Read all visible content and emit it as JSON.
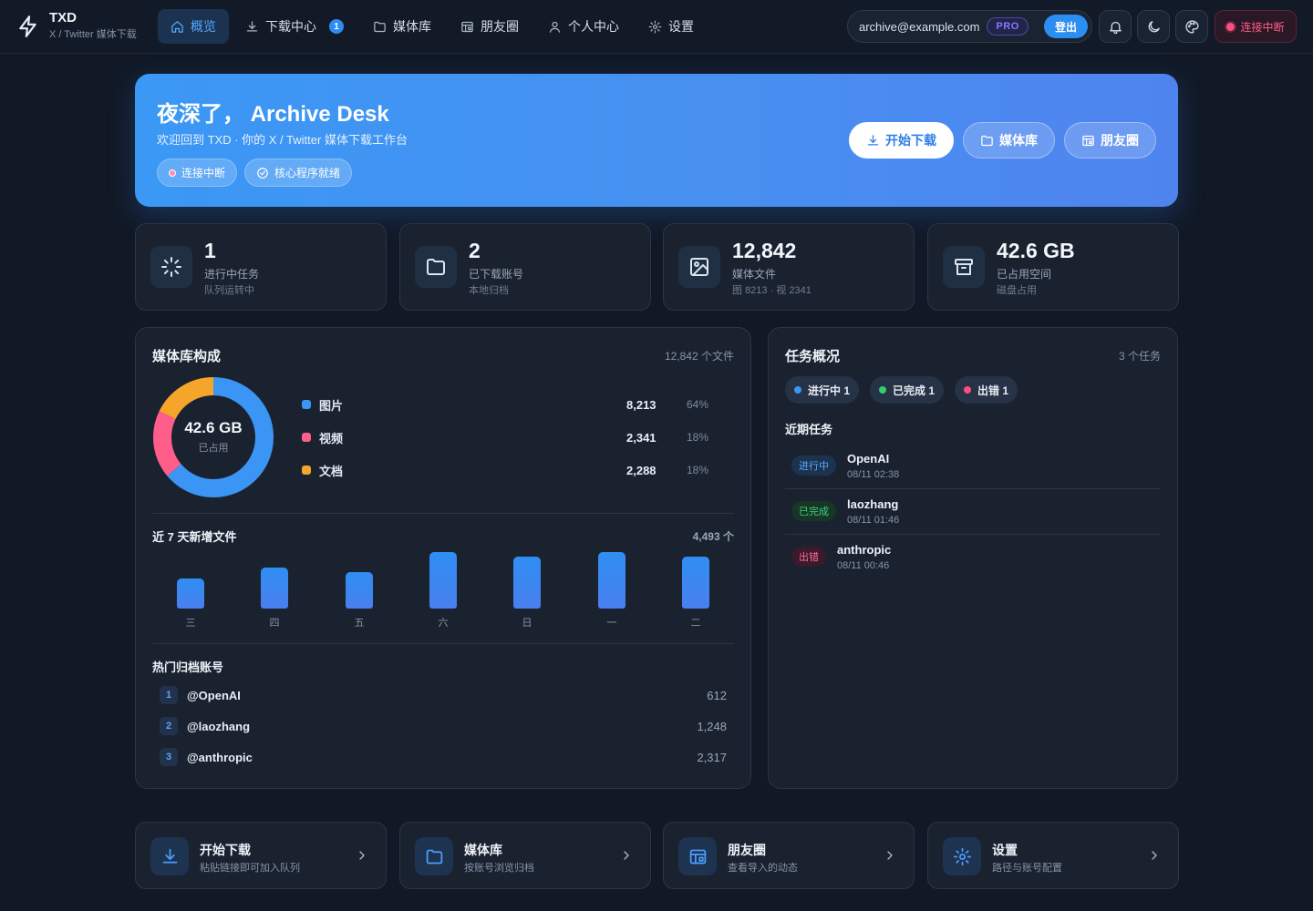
{
  "brand": {
    "title": "TXD",
    "subtitle": "X / Twitter 媒体下载"
  },
  "nav": [
    {
      "label": "概览",
      "icon": "home-icon",
      "active": true
    },
    {
      "label": "下载中心",
      "icon": "download-icon",
      "badge": "1"
    },
    {
      "label": "媒体库",
      "icon": "folder-icon"
    },
    {
      "label": "朋友圈",
      "icon": "layout-icon"
    },
    {
      "label": "个人中心",
      "icon": "user-icon"
    },
    {
      "label": "设置",
      "icon": "gear-icon"
    }
  ],
  "account": {
    "email": "archive@example.com",
    "plan": "PRO",
    "logout": "登出"
  },
  "connection": {
    "label": "连接中断",
    "color": "#ff4d7e"
  },
  "hero": {
    "title": "夜深了， Archive Desk",
    "subtitle": "欢迎回到 TXD · 你的 X / Twitter 媒体下载工作台",
    "tags": [
      "连接中断",
      "核心程序就绪"
    ],
    "buttons": [
      "开始下载",
      "媒体库",
      "朋友圈"
    ]
  },
  "stats": [
    {
      "value": "1",
      "label": "进行中任务",
      "sub": "队列运转中",
      "icon": "loader-icon"
    },
    {
      "value": "2",
      "label": "已下载账号",
      "sub": "本地归档",
      "icon": "folder-icon"
    },
    {
      "value": "12,842",
      "label": "媒体文件",
      "sub": "图 8213 · 视 2341",
      "icon": "image-icon"
    },
    {
      "value": "42.6 GB",
      "label": "已占用空间",
      "sub": "磁盘占用",
      "icon": "archive-icon"
    }
  ],
  "library": {
    "title": "媒体库构成",
    "meta": "12,842 个文件",
    "donut_center": "42.6 GB",
    "donut_sub": "已占用",
    "legend": [
      {
        "name": "图片",
        "value": "8,213",
        "pct": "64%",
        "color": "#3a95f5"
      },
      {
        "name": "视频",
        "value": "2,341",
        "pct": "18%",
        "color": "#ff5d8a"
      },
      {
        "name": "文档",
        "value": "2,288",
        "pct": "18%",
        "color": "#f5a52a"
      }
    ],
    "weekly_title": "近 7 天新增文件",
    "weekly_total": "4,493 个",
    "top_title": "热门归档账号",
    "top_accounts": [
      {
        "rank": "1",
        "name": "@OpenAI",
        "count": "612"
      },
      {
        "rank": "2",
        "name": "@laozhang",
        "count": "1,248"
      },
      {
        "rank": "3",
        "name": "@anthropic",
        "count": "2,317"
      }
    ]
  },
  "chart_data": [
    {
      "type": "pie",
      "categories": [
        "图片",
        "视频",
        "文档"
      ],
      "values": [
        8213,
        2341,
        2288
      ],
      "colors": [
        "#3a95f5",
        "#ff5d8a",
        "#f5a52a"
      ]
    },
    {
      "type": "bar",
      "title": "近 7 天新增文件",
      "categories": [
        "三",
        "四",
        "五",
        "六",
        "日",
        "一",
        "二"
      ],
      "values": [
        33,
        45,
        40,
        62,
        57,
        62,
        57
      ],
      "grid": false
    }
  ],
  "tasks": {
    "title": "任务概况",
    "meta": "3 个任务",
    "chips": [
      {
        "label": "进行中 1",
        "color": "#3a95f5"
      },
      {
        "label": "已完成 1",
        "color": "#2fcf6e"
      },
      {
        "label": "出错 1",
        "color": "#ff4d7e"
      }
    ],
    "recent_title": "近期任务",
    "recent": [
      {
        "status": "进行中",
        "name": "OpenAI",
        "time": "08/11 02:38",
        "fg": "#5aa8ff",
        "bg": "#1c3350"
      },
      {
        "status": "已完成",
        "name": "laozhang",
        "time": "08/11 01:46",
        "fg": "#3fd07c",
        "bg": "#173626"
      },
      {
        "status": "出错",
        "name": "anthropic",
        "time": "08/11 00:46",
        "fg": "#ff6b95",
        "bg": "#3a1a2b"
      }
    ]
  },
  "quick_links": [
    {
      "title": "开始下载",
      "sub": "粘贴链接即可加入队列",
      "icon": "download-icon"
    },
    {
      "title": "媒体库",
      "sub": "按账号浏览归档",
      "icon": "folder-icon"
    },
    {
      "title": "朋友圈",
      "sub": "查看导入的动态",
      "icon": "layout-icon"
    },
    {
      "title": "设置",
      "sub": "路径与账号配置",
      "icon": "gear-icon"
    }
  ]
}
